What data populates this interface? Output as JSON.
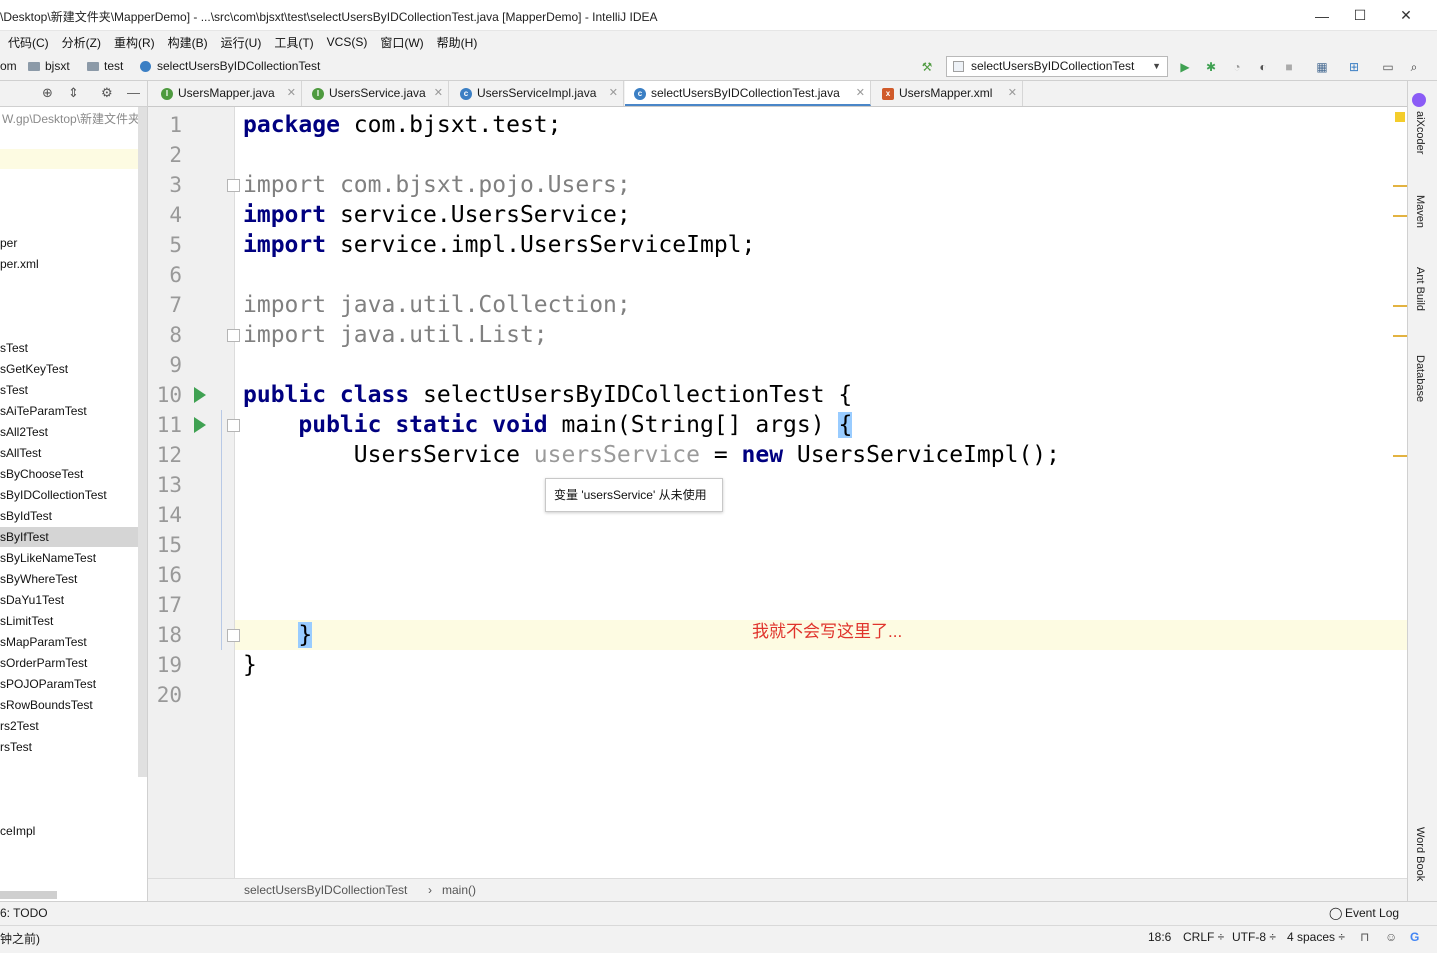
{
  "window": {
    "title": "\\Desktop\\新建文件夹\\MapperDemo] - ...\\src\\com\\bjsxt\\test\\selectUsersByIDCollectionTest.java [MapperDemo] - IntelliJ IDEA",
    "minimize": "—",
    "maximize": "☐",
    "close": "✕"
  },
  "menu": [
    "代码(C)",
    "分析(Z)",
    "重构(R)",
    "构建(B)",
    "运行(U)",
    "工具(T)",
    "VCS(S)",
    "窗口(W)",
    "帮助(H)"
  ],
  "nav": {
    "crumb_partial": "om",
    "crumb_1": "bjsxt",
    "crumb_2": "test",
    "crumb_3": "selectUsersByIDCollectionTest",
    "run_config": "selectUsersByIDCollectionTest"
  },
  "project": {
    "path": "W.gp\\Desktop\\新建文件夹",
    "items": [
      "per",
      "per.xml",
      "sTest",
      "sGetKeyTest",
      "sTest",
      "sAiTeParamTest",
      "sAll2Test",
      "sAllTest",
      "sByChooseTest",
      "sByIDCollectionTest",
      "sByIdTest",
      "sByIfTest",
      "sByLikeNameTest",
      "sByWhereTest",
      "sDaYu1Test",
      "sLimitTest",
      "sMapParamTest",
      "sOrderParmTest",
      "sPOJOParamTest",
      "sRowBoundsTest",
      "rs2Test",
      "rsTest",
      "ceImpl"
    ],
    "selected_item": "sByIfTest"
  },
  "tabs": [
    {
      "label": "UsersMapper.java",
      "icon": "I",
      "color": "#4e9a3f",
      "close": "✕"
    },
    {
      "label": "UsersService.java",
      "icon": "I",
      "color": "#4e9a3f",
      "close": "✕"
    },
    {
      "label": "UsersServiceImpl.java",
      "icon": "c",
      "color": "#3b7fc4",
      "close": "✕"
    },
    {
      "label": "selectUsersByIDCollectionTest.java",
      "icon": "c",
      "color": "#3b7fc4",
      "close": "✕",
      "active": true
    },
    {
      "label": "UsersMapper.xml",
      "icon": "x",
      "color": "#d05a2a",
      "close": "✕"
    }
  ],
  "editor": {
    "line_numbers": [
      "1",
      "2",
      "3",
      "4",
      "5",
      "6",
      "7",
      "8",
      "9",
      "10",
      "11",
      "12",
      "13",
      "14",
      "15",
      "16",
      "17",
      "18",
      "19",
      "20"
    ],
    "code": {
      "l1_kw": "package",
      "l1_rest": " com.bjsxt.test;",
      "l3_kw": "import",
      "l3_rest": " com.bjsxt.pojo.Users;",
      "l4_kw": "import",
      "l4_rest": " service.UsersService;",
      "l5_kw": "import",
      "l5_rest": " service.impl.UsersServiceImpl;",
      "l7_kw": "import",
      "l7_rest": " java.util.Collection;",
      "l8_kw": "import",
      "l8_rest": " java.util.List;",
      "l10_kw": "public class",
      "l10_rest": " selectUsersByIDCollectionTest {",
      "l11_indent": "    ",
      "l11_kw": "public static void",
      "l11_rest": " main(String[] args) ",
      "l11_brace": "{",
      "l12_a": "        UsersService ",
      "l12_var": "usersService",
      "l12_b": " = ",
      "l12_kw": "new",
      "l12_c": " UsersServiceImpl();",
      "l18_indent": "    ",
      "l18_brace": "}",
      "l19": "}"
    },
    "tooltip": "变量 'usersService' 从未使用",
    "annotation": "我就不会写这里了...",
    "annotation_color": "#e0342c"
  },
  "breadcrumb": {
    "item1": "selectUsersByIDCollectionTest",
    "sep": "›",
    "item2": "main()"
  },
  "right_tools": [
    "aiXcoder",
    "Maven",
    "Ant Build",
    "Database",
    "Word Book"
  ],
  "toolwindows": {
    "todo": "6: TODO",
    "event_log": "Event Log"
  },
  "status": {
    "left_partial": "钟之前)",
    "position": "18:6",
    "line_sep": "CRLF ÷",
    "encoding": "UTF-8 ÷",
    "indent": "4 spaces ÷"
  }
}
